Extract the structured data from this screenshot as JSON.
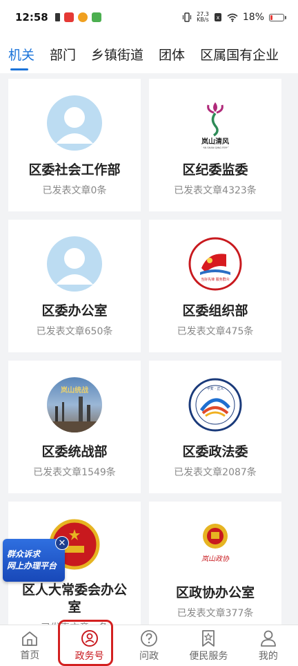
{
  "status": {
    "time": "12:58",
    "net_speed_value": "27.3",
    "net_speed_unit": "KB/s",
    "battery": "18%",
    "battery_level": 0.18
  },
  "tabs": [
    {
      "label": "机关",
      "active": true
    },
    {
      "label": "部门",
      "active": false
    },
    {
      "label": "乡镇街道",
      "active": false
    },
    {
      "label": "团体",
      "active": false
    },
    {
      "label": "区属国有企业",
      "active": false
    }
  ],
  "cards": [
    {
      "name": "区委社会工作部",
      "count": "已发表文章0条",
      "avatar": "default-avatar-icon"
    },
    {
      "name": "区纪委监委",
      "count": "已发表文章4323条",
      "avatar": "lanshan-qingfeng-logo",
      "logo_text": "岚山清风",
      "logo_sub": "LAN SHAN QING FENG"
    },
    {
      "name": "区委办公室",
      "count": "已发表文章650条",
      "avatar": "default-avatar-icon"
    },
    {
      "name": "区委组织部",
      "count": "已发表文章475条",
      "avatar": "party-flag-logo",
      "logo_text": "当好先锋 服务群众"
    },
    {
      "name": "区委统战部",
      "count": "已发表文章1549条",
      "avatar": "city-photo-logo",
      "logo_text": "岚山统战"
    },
    {
      "name": "区委政法委",
      "count": "已发表文章2087条",
      "avatar": "politics-law-logo",
      "logo_text": "平安 · 正义"
    },
    {
      "name": "区人大常委会办公室",
      "count": "已发表文章...条",
      "avatar": "national-emblem-logo"
    },
    {
      "name": "区政协办公室",
      "count": "已发表文章377条",
      "avatar": "cppcc-emblem-logo",
      "logo_text": "岚山政协"
    }
  ],
  "float_banner": {
    "line1": "群众诉求",
    "line2": "网上办理平台"
  },
  "bottom_nav": [
    {
      "label": "首页",
      "icon": "home-icon",
      "active": false
    },
    {
      "label": "政务号",
      "icon": "government-account-icon",
      "active": true
    },
    {
      "label": "问政",
      "icon": "question-icon",
      "active": false
    },
    {
      "label": "便民服务",
      "icon": "bookmark-star-icon",
      "active": false
    },
    {
      "label": "我的",
      "icon": "person-icon",
      "active": false
    }
  ],
  "colors": {
    "accent": "#1a73d9",
    "active_nav": "#c8191e",
    "highlight": "#d32020"
  }
}
